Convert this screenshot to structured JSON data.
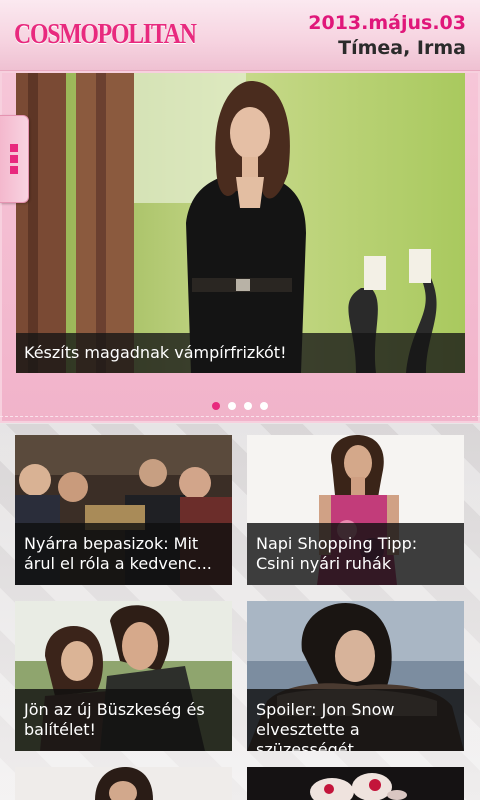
{
  "header": {
    "logo_text": "COSMOPOLITAN",
    "date": "2013.május.03",
    "namedays": "Tímea, Irma",
    "brand_color": "#e8297e"
  },
  "side_menu": {
    "icon": "menu-dots-icon"
  },
  "carousel": {
    "caption": "Készíts magadnak vámpírfrizkót!",
    "page_count": 4,
    "active_index": 0
  },
  "articles": [
    {
      "title": "Nyárra bepasizok: Mit árul el róla a kedvenc..."
    },
    {
      "title": "Napi Shopping Tipp: Csini nyári ruhák"
    },
    {
      "title": "Jön az új Büszkeség és balítélet!"
    },
    {
      "title": "Spoiler: Jon Snow elvesztette a szüzességét"
    }
  ]
}
